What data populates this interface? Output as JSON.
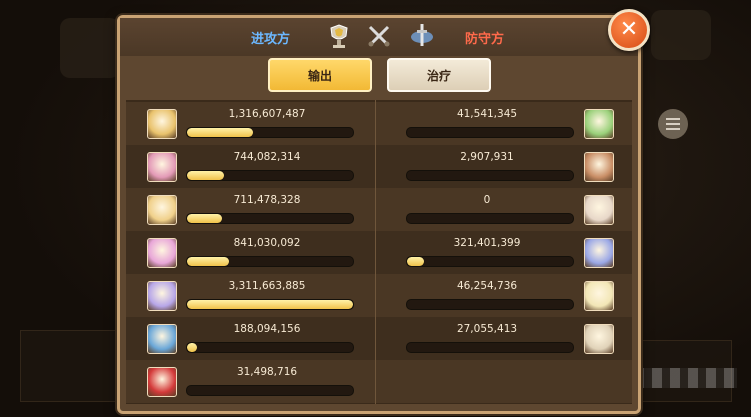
{
  "header": {
    "attack_label": "进攻方",
    "defend_label": "防守方",
    "icons": [
      "trophy-badge-icon",
      "crossed-swords-icon",
      "sword-emblem-icon"
    ]
  },
  "close_button": {
    "icon": "close-x-icon",
    "symbol": "✕"
  },
  "tabs": [
    {
      "label": "输出",
      "selected": true
    },
    {
      "label": "治疗",
      "selected": false
    }
  ],
  "rows": [
    {
      "attacker": {
        "value": "1,316,607,487",
        "fill": 0.4,
        "avatar_color": "#e9c26c"
      },
      "defender": {
        "value": "41,541,345",
        "fill": 0.0,
        "avatar_color": "#9ad07a"
      }
    },
    {
      "attacker": {
        "value": "744,082,314",
        "fill": 0.22,
        "avatar_color": "#e39ab7"
      },
      "defender": {
        "value": "2,907,931",
        "fill": 0.0,
        "avatar_color": "#c98e66"
      }
    },
    {
      "attacker": {
        "value": "711,478,328",
        "fill": 0.21,
        "avatar_color": "#f0d08a"
      },
      "defender": {
        "value": "0",
        "fill": 0.0,
        "avatar_color": "#e7d7c8"
      }
    },
    {
      "attacker": {
        "value": "841,030,092",
        "fill": 0.25,
        "avatar_color": "#e8a6d8"
      },
      "defender": {
        "value": "321,401,399",
        "fill": 0.1,
        "avatar_color": "#9aa7e6"
      }
    },
    {
      "attacker": {
        "value": "3,311,663,885",
        "fill": 1.0,
        "avatar_color": "#b7a6e8"
      },
      "defender": {
        "value": "46,254,736",
        "fill": 0.0,
        "avatar_color": "#f2e6b6"
      }
    },
    {
      "attacker": {
        "value": "188,094,156",
        "fill": 0.06,
        "avatar_color": "#6aa7d8"
      },
      "defender": {
        "value": "27,055,413",
        "fill": 0.0,
        "avatar_color": "#e0d2b8"
      }
    },
    {
      "attacker": {
        "value": "31,498,716",
        "fill": 0.0,
        "avatar_color": "#d43a3a"
      },
      "defender": null
    }
  ],
  "background": {
    "menu_icon": "list-menu-icon"
  }
}
